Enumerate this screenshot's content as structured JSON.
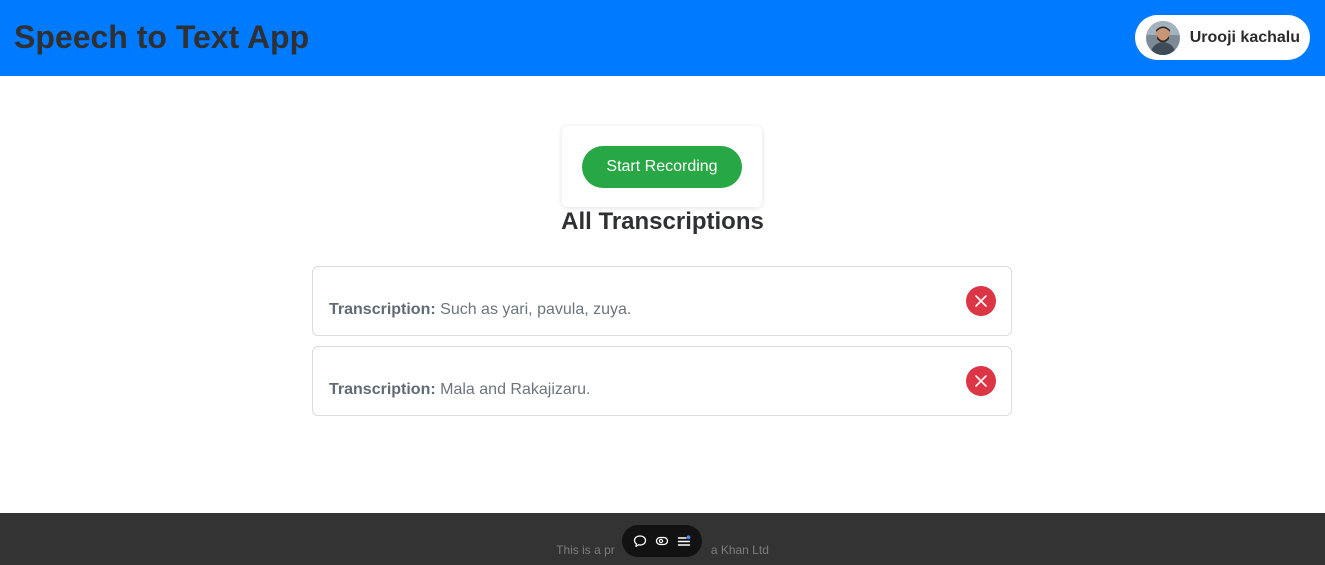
{
  "header": {
    "title": "Speech to Text App",
    "user": {
      "name": "Urooji kachalu",
      "avatar_icon": "user-avatar"
    }
  },
  "recorder": {
    "button_label": "Start Recording"
  },
  "transcriptions": {
    "heading": "All Transcriptions",
    "label": "Transcription:",
    "items": [
      {
        "text": "Such as yari, pavula, zuya."
      },
      {
        "text": "Mala and Rakajizaru."
      }
    ],
    "delete_icon": "close-icon"
  },
  "footer": {
    "text_left": "This is a pr",
    "text_right": "a Khan Ltd"
  },
  "floating_toolbar": {
    "icons": [
      "chat-bubble-icon",
      "eye-icon",
      "menu-icon"
    ]
  },
  "colors": {
    "header_bg": "#007bff",
    "record_button": "#28a745",
    "delete_button": "#dc3545",
    "footer_bg": "#333333"
  }
}
